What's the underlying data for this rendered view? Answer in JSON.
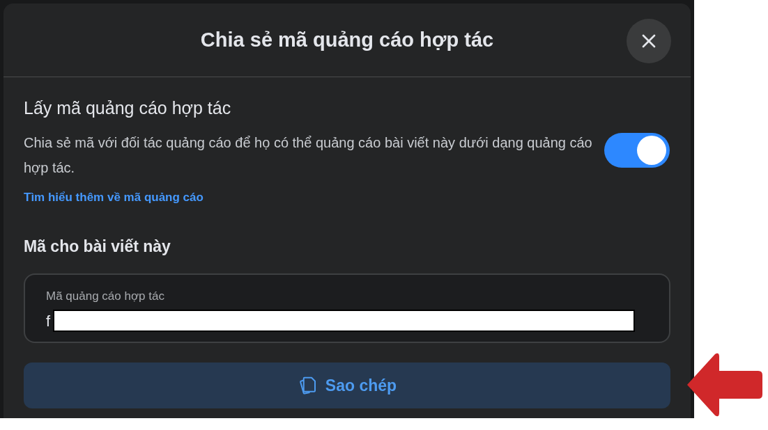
{
  "dialog": {
    "title": "Chia sẻ mã quảng cáo hợp tác"
  },
  "setting": {
    "title": "Lấy mã quảng cáo hợp tác",
    "description": "Chia sẻ mã với đối tác quảng cáo để họ có thể quảng cáo bài viết này dưới dạng quảng cáo hợp tác.",
    "on": true,
    "link": "Tìm hiểu thêm về mã quảng cáo"
  },
  "code_section": {
    "heading": "Mã cho bài viết này",
    "field": {
      "label": "Mã quảng cáo hợp tác",
      "value": "f"
    }
  },
  "copy_button": {
    "label": "Sao chép"
  }
}
